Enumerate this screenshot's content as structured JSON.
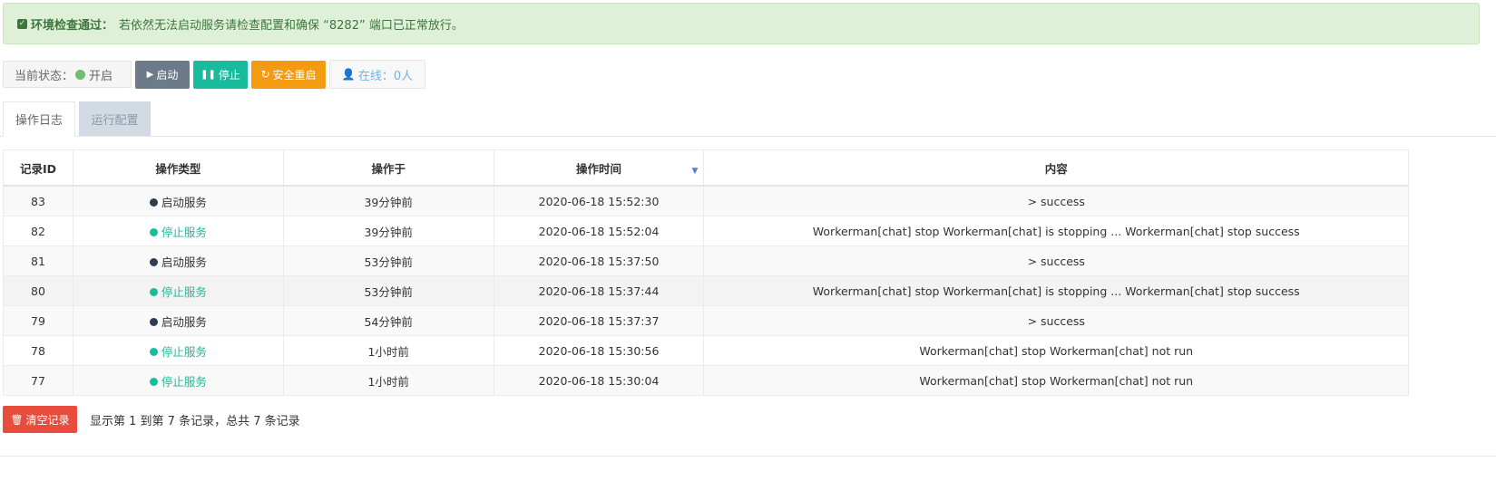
{
  "alert": {
    "title": "环境检查通过：",
    "message": "若依然无法启动服务请检查配置和确保 “8282” 端口已正常放行。"
  },
  "toolbar": {
    "status_label": "当前状态：",
    "status_value": "开启",
    "status_color": "#6cbf6c",
    "start_label": "启动",
    "stop_label": "停止",
    "restart_label": "安全重启",
    "online_label": "在线：0人"
  },
  "tabs": [
    {
      "label": "操作日志",
      "active": true
    },
    {
      "label": "运行配置",
      "active": false
    }
  ],
  "table": {
    "headers": [
      "记录ID",
      "操作类型",
      "操作于",
      "操作时间",
      "内容"
    ],
    "rows": [
      {
        "id": "83",
        "type": "启动服务",
        "kind": "start",
        "ago": "39分钟前",
        "time": "2020-06-18 15:52:30",
        "content": "> success"
      },
      {
        "id": "82",
        "type": "停止服务",
        "kind": "stop",
        "ago": "39分钟前",
        "time": "2020-06-18 15:52:04",
        "content": "Workerman[chat] stop Workerman[chat] is stopping ... Workerman[chat] stop success"
      },
      {
        "id": "81",
        "type": "启动服务",
        "kind": "start",
        "ago": "53分钟前",
        "time": "2020-06-18 15:37:50",
        "content": "> success"
      },
      {
        "id": "80",
        "type": "停止服务",
        "kind": "stop",
        "ago": "53分钟前",
        "time": "2020-06-18 15:37:44",
        "content": "Workerman[chat] stop Workerman[chat] is stopping ... Workerman[chat] stop success"
      },
      {
        "id": "79",
        "type": "启动服务",
        "kind": "start",
        "ago": "54分钟前",
        "time": "2020-06-18 15:37:37",
        "content": "> success"
      },
      {
        "id": "78",
        "type": "停止服务",
        "kind": "stop",
        "ago": "1小时前",
        "time": "2020-06-18 15:30:56",
        "content": "Workerman[chat] stop Workerman[chat] not run"
      },
      {
        "id": "77",
        "type": "停止服务",
        "kind": "stop",
        "ago": "1小时前",
        "time": "2020-06-18 15:30:04",
        "content": "Workerman[chat] stop Workerman[chat] not run"
      }
    ]
  },
  "footer": {
    "clear_label": "清空记录",
    "pagination_info": "显示第 1 到第 7 条记录，总共 7 条记录"
  },
  "colors": {
    "start_dot": "#2c3e50",
    "stop": "#18bc9c",
    "btn_start": "#6c7a89",
    "btn_stop": "#18bc9c",
    "btn_restart": "#f39c12",
    "btn_clear": "#e74c3c"
  }
}
